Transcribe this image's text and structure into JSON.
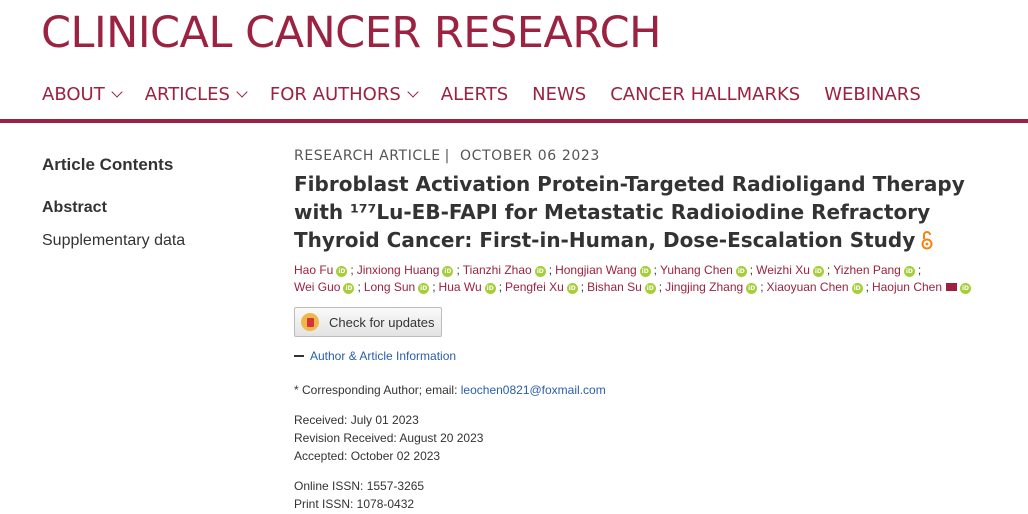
{
  "site": {
    "logo": "CLINICAL CANCER RESEARCH",
    "brand_color": "#9b2240"
  },
  "nav": [
    {
      "label": "ABOUT",
      "dropdown": true
    },
    {
      "label": "ARTICLES",
      "dropdown": true
    },
    {
      "label": "FOR AUTHORS",
      "dropdown": true
    },
    {
      "label": "ALERTS",
      "dropdown": false
    },
    {
      "label": "NEWS",
      "dropdown": false
    },
    {
      "label": "CANCER HALLMARKS",
      "dropdown": false
    },
    {
      "label": "WEBINARS",
      "dropdown": false
    }
  ],
  "sidebar": {
    "title": "Article Contents",
    "items": [
      {
        "label": "Abstract",
        "active": true
      },
      {
        "label": "Supplementary data",
        "active": false
      }
    ]
  },
  "article": {
    "type": "RESEARCH ARTICLE",
    "separator": "|",
    "date": "OCTOBER 06 2023",
    "title_lines": [
      "Fibroblast Activation Protein-Targeted Radioligand Therapy",
      "with ¹⁷⁷Lu-EB-FAPI for Metastatic Radioiodine Refractory",
      "Thyroid Cancer: First-in-Human, Dose-Escalation Study"
    ],
    "open_access_icon": "open-access-icon",
    "authors_line1": [
      "Hao Fu",
      "Jinxiong Huang",
      "Tianzhi Zhao",
      "Hongjian Wang",
      "Yuhang Chen",
      "Weizhi Xu",
      "Yizhen Pang"
    ],
    "authors_line2": [
      "Wei Guo",
      "Long Sun",
      "Hua Wu",
      "Pengfei Xu",
      "Bishan Su",
      "Jingjing Zhang",
      "Xiaoyuan Chen",
      "Haojun Chen"
    ],
    "orcid_glyph": "iD",
    "author_separator": ";",
    "check_updates_label": "Check for updates",
    "author_info_label": "Author & Article Information",
    "corresponding_prefix": "* Corresponding Author; email: ",
    "corresponding_email": "leochen0821@foxmail.com",
    "received": "Received: July 01 2023",
    "revision": "Revision Received: August 20 2023",
    "accepted": "Accepted: October 02 2023",
    "online_issn": "Online ISSN: 1557-3265",
    "print_issn": "Print ISSN: 1078-0432"
  }
}
